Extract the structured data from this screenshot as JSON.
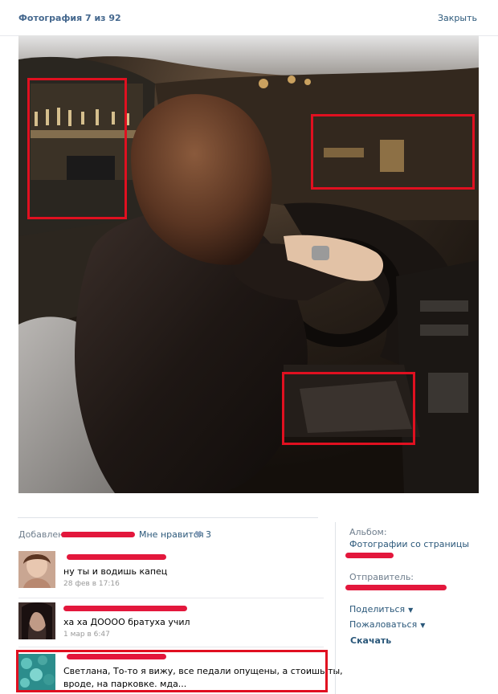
{
  "header": {
    "title": "Фотография 7 из 92",
    "close_label": "Закрыть"
  },
  "photo": {
    "description_icon": "car-interior-photo"
  },
  "meta": {
    "added_label": "Добавлена",
    "like_label": "Мне нравится",
    "like_count": "3"
  },
  "comments": [
    {
      "text": "ну ты и водишь капец",
      "date": "28 фев в 17:16"
    },
    {
      "text": "ха ха ДОООО братуха учил",
      "date": "1 мар в 6:47"
    },
    {
      "text_line1": "Светлана, То-то я вижу, все педали опущены, а стоишь ты,",
      "text_line2": "вроде, на парковке. мда..."
    }
  ],
  "sidebar": {
    "album_label": "Альбом:",
    "album_link": "Фотографии со страницы",
    "sender_label": "Отправитель:",
    "share_label": "Поделиться",
    "report_label": "Пожаловаться",
    "download_label": "Скачать"
  },
  "colors": {
    "link": "#2b587a",
    "highlight": "#e01020",
    "redaction": "#e3173c"
  }
}
